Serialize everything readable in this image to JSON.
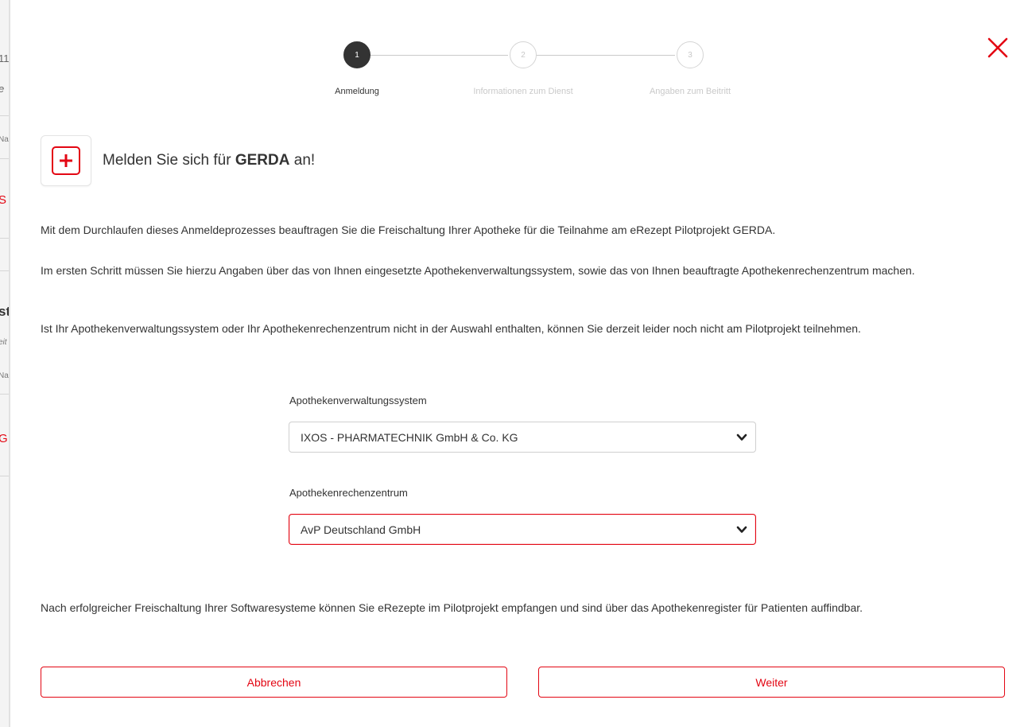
{
  "background_page": {
    "fragments": [
      "11",
      "e",
      "Na",
      "S",
      "st",
      "eit",
      "Na",
      "G"
    ]
  },
  "stepper": {
    "steps": [
      {
        "number": "1",
        "label": "Anmeldung",
        "state": "active"
      },
      {
        "number": "2",
        "label": "Informationen zum Dienst",
        "state": "inactive"
      },
      {
        "number": "3",
        "label": "Angaben zum Beitritt",
        "state": "inactive"
      }
    ]
  },
  "heading": {
    "prefix": "Melden Sie sich für ",
    "brand": "GERDA",
    "suffix": " an!"
  },
  "paragraphs": {
    "intro": "Mit dem Durchlaufen dieses Anmeldeprozesses beauftragen Sie die Freischaltung Ihrer Apotheke für die Teilnahme am eRezept Pilotprojekt GERDA.",
    "step_one": "Im ersten Schritt müssen Sie hierzu Angaben über das von Ihnen eingesetzte Apothekenverwaltungssystem, sowie das von Ihnen beauftragte Apothekenrechenzentrum machen.",
    "not_listed": "Ist Ihr Apothekenverwaltungssystem oder Ihr Apothekenrechenzentrum nicht in der Auswahl enthalten, können Sie derzeit leider noch nicht am Pilotprojekt teilnehmen.",
    "after": "Nach erfolgreicher Freischaltung Ihrer Softwaresysteme können Sie eRezepte im Pilotprojekt empfangen und sind über das Apothekenregister für Patienten auffindbar."
  },
  "form": {
    "system_label": "Apothekenverwaltungssystem",
    "system_value": "IXOS - PHARMATECHNIK GmbH & Co. KG",
    "center_label": "Apothekenrechenzentrum",
    "center_value": "AvP Deutschland GmbH"
  },
  "buttons": {
    "cancel": "Abbrechen",
    "next": "Weiter"
  },
  "colors": {
    "accent": "#e30613",
    "active_step": "#333333",
    "inactive_step": "#c9c9c9"
  },
  "icons": {
    "close": "close-icon",
    "plus": "plus-icon",
    "chevron": "chevron-down-icon"
  }
}
